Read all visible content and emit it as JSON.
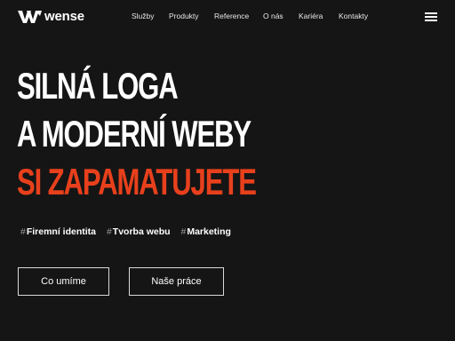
{
  "brand": {
    "name": "wense"
  },
  "nav": {
    "items": [
      "Služby",
      "Produkty",
      "Reference",
      "O nás",
      "Kariéra",
      "Kontakty"
    ]
  },
  "hero": {
    "line1": "SILNÁ LOGA",
    "line2": "A MODERNÍ WEBY",
    "line3": "SI ZAPAMATUJETE",
    "accent_color": "#e8401c"
  },
  "tags": [
    {
      "hash": "#",
      "label": "Firemní identita"
    },
    {
      "hash": "#",
      "label": "Tvorba webu"
    },
    {
      "hash": "#",
      "label": "Marketing"
    }
  ],
  "buttons": {
    "primary": "Co umíme",
    "secondary": "Naše práce"
  },
  "icons": {
    "menu": "hamburger-icon",
    "logo": "wense-logo-mark"
  }
}
